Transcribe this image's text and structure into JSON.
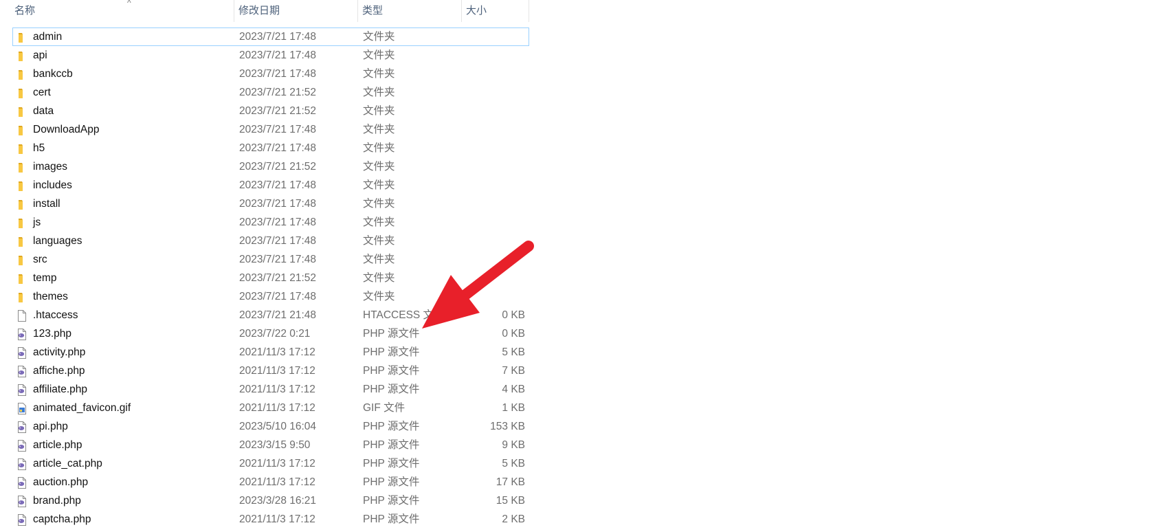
{
  "columns": {
    "name": "名称",
    "date": "修改日期",
    "type": "类型",
    "size": "大小",
    "sort_indicator": "^"
  },
  "files": [
    {
      "name": "admin",
      "date": "2023/7/21 17:48",
      "type": "文件夹",
      "size": "",
      "kind": "folder",
      "selected": true
    },
    {
      "name": "api",
      "date": "2023/7/21 17:48",
      "type": "文件夹",
      "size": "",
      "kind": "folder"
    },
    {
      "name": "bankccb",
      "date": "2023/7/21 17:48",
      "type": "文件夹",
      "size": "",
      "kind": "folder"
    },
    {
      "name": "cert",
      "date": "2023/7/21 21:52",
      "type": "文件夹",
      "size": "",
      "kind": "folder"
    },
    {
      "name": "data",
      "date": "2023/7/21 21:52",
      "type": "文件夹",
      "size": "",
      "kind": "folder"
    },
    {
      "name": "DownloadApp",
      "date": "2023/7/21 17:48",
      "type": "文件夹",
      "size": "",
      "kind": "folder"
    },
    {
      "name": "h5",
      "date": "2023/7/21 17:48",
      "type": "文件夹",
      "size": "",
      "kind": "folder"
    },
    {
      "name": "images",
      "date": "2023/7/21 21:52",
      "type": "文件夹",
      "size": "",
      "kind": "folder"
    },
    {
      "name": "includes",
      "date": "2023/7/21 17:48",
      "type": "文件夹",
      "size": "",
      "kind": "folder"
    },
    {
      "name": "install",
      "date": "2023/7/21 17:48",
      "type": "文件夹",
      "size": "",
      "kind": "folder"
    },
    {
      "name": "js",
      "date": "2023/7/21 17:48",
      "type": "文件夹",
      "size": "",
      "kind": "folder"
    },
    {
      "name": "languages",
      "date": "2023/7/21 17:48",
      "type": "文件夹",
      "size": "",
      "kind": "folder"
    },
    {
      "name": "src",
      "date": "2023/7/21 17:48",
      "type": "文件夹",
      "size": "",
      "kind": "folder"
    },
    {
      "name": "temp",
      "date": "2023/7/21 21:52",
      "type": "文件夹",
      "size": "",
      "kind": "folder"
    },
    {
      "name": "themes",
      "date": "2023/7/21 17:48",
      "type": "文件夹",
      "size": "",
      "kind": "folder"
    },
    {
      "name": ".htaccess",
      "date": "2023/7/21 21:48",
      "type": "HTACCESS 文",
      "size": "0 KB",
      "kind": "file"
    },
    {
      "name": "123.php",
      "date": "2023/7/22 0:21",
      "type": "PHP 源文件",
      "size": "0 KB",
      "kind": "php"
    },
    {
      "name": "activity.php",
      "date": "2021/11/3 17:12",
      "type": "PHP 源文件",
      "size": "5 KB",
      "kind": "php"
    },
    {
      "name": "affiche.php",
      "date": "2021/11/3 17:12",
      "type": "PHP 源文件",
      "size": "7 KB",
      "kind": "php"
    },
    {
      "name": "affiliate.php",
      "date": "2021/11/3 17:12",
      "type": "PHP 源文件",
      "size": "4 KB",
      "kind": "php"
    },
    {
      "name": "animated_favicon.gif",
      "date": "2021/11/3 17:12",
      "type": "GIF 文件",
      "size": "1 KB",
      "kind": "gif"
    },
    {
      "name": "api.php",
      "date": "2023/5/10 16:04",
      "type": "PHP 源文件",
      "size": "153 KB",
      "kind": "php"
    },
    {
      "name": "article.php",
      "date": "2023/3/15 9:50",
      "type": "PHP 源文件",
      "size": "9 KB",
      "kind": "php"
    },
    {
      "name": "article_cat.php",
      "date": "2021/11/3 17:12",
      "type": "PHP 源文件",
      "size": "5 KB",
      "kind": "php"
    },
    {
      "name": "auction.php",
      "date": "2021/11/3 17:12",
      "type": "PHP 源文件",
      "size": "17 KB",
      "kind": "php"
    },
    {
      "name": "brand.php",
      "date": "2023/3/28 16:21",
      "type": "PHP 源文件",
      "size": "15 KB",
      "kind": "php"
    },
    {
      "name": "captcha.php",
      "date": "2021/11/3 17:12",
      "type": "PHP 源文件",
      "size": "2 KB",
      "kind": "php"
    }
  ],
  "colors": {
    "folder": "#f8c843",
    "folder_dark": "#e0a820",
    "php": "#7b6bb8",
    "selection_border": "#99d1ff",
    "arrow": "#e8202a"
  },
  "icons": {
    "folder": "folder-icon",
    "file": "file-icon",
    "php": "php-file-icon",
    "gif": "gif-file-icon",
    "annotation": "red-arrow-icon"
  }
}
